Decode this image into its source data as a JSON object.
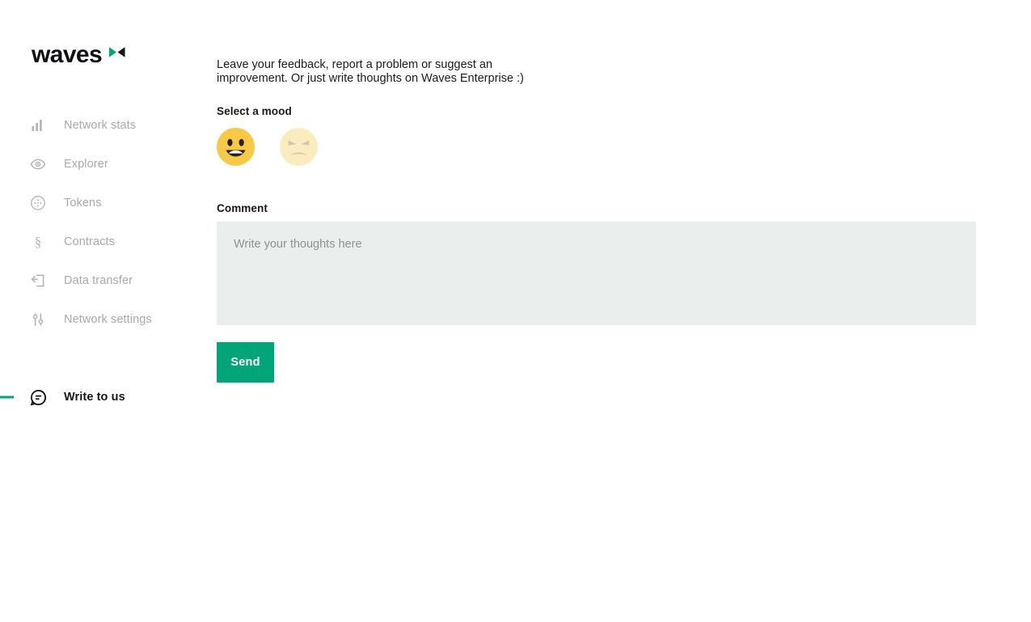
{
  "brand": {
    "name": "waves",
    "mark_icon": "waves-logo-mark",
    "accent_color": "#02a578",
    "text_color": "#0f1014"
  },
  "sidebar": {
    "items": [
      {
        "label": "Network stats",
        "icon": "bar-chart-icon",
        "active": false
      },
      {
        "label": "Explorer",
        "icon": "eye-icon",
        "active": false
      },
      {
        "label": "Tokens",
        "icon": "token-circle-icon",
        "active": false
      },
      {
        "label": "Contracts",
        "icon": "section-sign-icon",
        "active": false
      },
      {
        "label": "Data transfer",
        "icon": "data-transfer-icon",
        "active": false
      },
      {
        "label": "Network settings",
        "icon": "sliders-icon",
        "active": false
      },
      {
        "label": "Write to us",
        "icon": "speech-bubble-icon",
        "active": true
      }
    ]
  },
  "main": {
    "intro_text": "Leave your feedback, report a problem or suggest an improvement. Or just write thoughts on Waves Enterprise :)",
    "mood": {
      "label": "Select a mood",
      "options": [
        {
          "name": "happy",
          "icon": "grinning-face-icon",
          "selected": true
        },
        {
          "name": "angry",
          "icon": "angry-face-icon",
          "selected": false
        }
      ]
    },
    "comment": {
      "label": "Comment",
      "placeholder": "Write your thoughts here",
      "value": ""
    },
    "send_button": {
      "label": "Send",
      "color": "#02a578"
    }
  },
  "colors": {
    "accent_green": "#02a578",
    "input_background": "#eaeeed",
    "muted_text": "#a9a9a9",
    "body_text": "#1b1c20",
    "page_background": "#ffffff"
  }
}
